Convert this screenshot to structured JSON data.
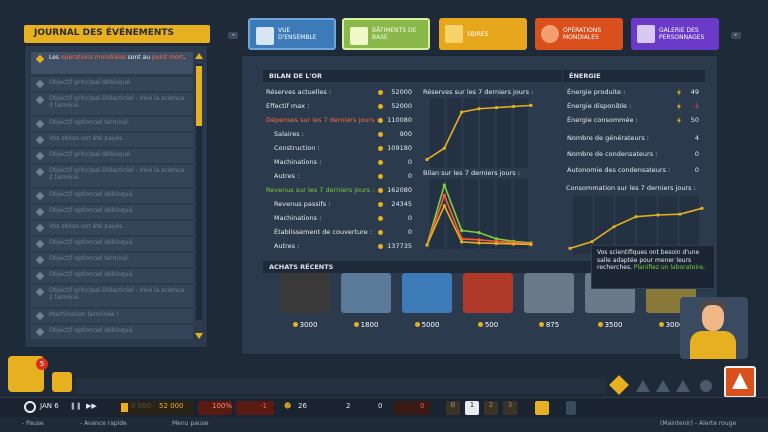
{
  "journal": {
    "title": "JOURNAL DES ÉVÉNEMENTS",
    "items": [
      {
        "pre": "Les ",
        "hl": "opérations mondiales",
        "mid": " sont au ",
        "hl2": "point mort",
        "post": ".",
        "active": true
      },
      {
        "text": "Objectif principal débloqué."
      },
      {
        "text": "Objectif principal Didacticiel - Vive la science 3 terminé."
      },
      {
        "text": "Objectif optionnel terminé."
      },
      {
        "text": "Vos sbires ont été payés."
      },
      {
        "text": "Objectif principal débloqué."
      },
      {
        "text": "Objectif principal Didacticiel - Vive la science 2 terminé."
      },
      {
        "text": "Objectif optionnel débloqué."
      },
      {
        "text": "Objectif optionnel débloqué."
      },
      {
        "text": "Vos sbires ont été payés."
      },
      {
        "text": "Objectif optionnel débloqué."
      },
      {
        "text": "Objectif optionnel terminé."
      },
      {
        "text": "Objectif optionnel débloqué."
      },
      {
        "text": "Objectif principal Didacticiel - Vive la science 1 terminé."
      },
      {
        "text": "Machination terminée !"
      },
      {
        "text": "Objectif optionnel débloqué."
      }
    ]
  },
  "tabs": [
    {
      "label": "VUE D'ENSEMBLE",
      "icon": "clipboard-icon"
    },
    {
      "label": "BÂTIMENTS DE BASE",
      "icon": "tools-icon"
    },
    {
      "label": "SBIRES",
      "icon": "minion-icon"
    },
    {
      "label": "OPÉRATIONS MONDIALES",
      "icon": "globe-icon"
    },
    {
      "label": "GALERIE DES PERSONNAGES",
      "icon": "portrait-icon"
    }
  ],
  "tab_keys": {
    "left": "◂",
    "right": "▸"
  },
  "gold": {
    "header": "BILAN DE L'OR",
    "reserves_label": "Réserves actuelles :",
    "reserves_value": "52000",
    "effectif_label": "Effectif max :",
    "effectif_value": "52000",
    "depenses_label": "Dépenses sur les 7 derniers jours :",
    "depenses_value": "110080",
    "salaires_label": "Salaires :",
    "salaires_value": "900",
    "construction_label": "Construction :",
    "construction_value": "109180",
    "machinations_label": "Machinations :",
    "machinations_value": "0",
    "autres_label": "Autres :",
    "autres_value": "0",
    "revenus_label": "Revenus sur les 7 derniers jours :",
    "revenus_value": "162080",
    "passifs_label": "Revenus passifs :",
    "passifs_value": "24345",
    "machinations2_label": "Machinations :",
    "machinations2_value": "0",
    "couverture_label": "Établissement de couverture :",
    "couverture_value": "0",
    "autres2_label": "Autres :",
    "autres2_value": "137735"
  },
  "energie": {
    "header": "ÉNERGIE",
    "produite_label": "Énergie produite :",
    "produite_value": "49",
    "disponible_label": "Énergie disponible :",
    "disponible_value": "-1",
    "consommee_label": "Énergie consommée :",
    "consommee_value": "50",
    "generateurs_label": "Nombre de générateurs :",
    "generateurs_value": "4",
    "condensateurs_label": "Nombre de condensateurs :",
    "condensateurs_value": "0",
    "autonomie_label": "Autonomie des condensateurs :",
    "autonomie_value": "0",
    "consommation_title": "Consommation sur les 7 derniers jours :"
  },
  "chart_data": [
    {
      "type": "line",
      "title": "Réserves sur les 7 derniers jours :",
      "x": [
        1,
        2,
        3,
        4,
        5,
        6,
        7
      ],
      "series": [
        {
          "values": [
            4000,
            14000,
            46000,
            49000,
            50000,
            51000,
            52000
          ],
          "color": "#e6b020"
        }
      ],
      "ylim": [
        0,
        55000
      ]
    },
    {
      "type": "line",
      "title": "Bilan sur les 7 derniers jours :",
      "x": [
        1,
        2,
        3,
        4,
        5,
        6,
        7
      ],
      "series": [
        {
          "values": [
            0,
            58000,
            14000,
            12000,
            6000,
            3500,
            2000
          ],
          "color": "#7ccf3e"
        },
        {
          "values": [
            0,
            48000,
            6000,
            5000,
            3500,
            2500,
            1200
          ],
          "color": "#ff5a3a"
        },
        {
          "values": [
            0,
            38000,
            3000,
            2000,
            1500,
            1000,
            500
          ],
          "color": "#e6b020"
        }
      ],
      "ylim": [
        0,
        60000
      ]
    },
    {
      "type": "line",
      "title": "Consommation sur les 7 derniers jours :",
      "x": [
        1,
        2,
        3,
        4,
        5,
        6,
        7
      ],
      "series": [
        {
          "values": [
            2,
            10,
            28,
            40,
            42,
            43,
            50
          ],
          "color": "#e6b020"
        }
      ],
      "ylim": [
        0,
        60
      ]
    }
  ],
  "achats": {
    "header": "ACHATS RÉCENTS",
    "items": [
      {
        "price": "3000",
        "color": "#3a3a3a",
        "icon": "generator-icon"
      },
      {
        "price": "1800",
        "color": "#5a7a9a",
        "icon": "room-icon"
      },
      {
        "price": "5000",
        "color": "#3d7ab8",
        "icon": "computer-icon"
      },
      {
        "price": "500",
        "color": "#b03a2a",
        "icon": "cabinet-icon"
      },
      {
        "price": "875",
        "color": "#6a7a8a",
        "icon": "room-icon"
      },
      {
        "price": "3500",
        "color": "#6a7a8a",
        "icon": "room-icon"
      },
      {
        "price": "3000",
        "color": "#8a7a3a",
        "icon": "machine-icon"
      }
    ]
  },
  "tooltip": {
    "text": "Vos scientifiques ont besoin d'une salle adaptée pour mener leurs recherches. ",
    "link": "Planifiez un laboratoire",
    "end": "."
  },
  "bottom": {
    "date": "JAN 6",
    "gold_dim": "0 000",
    "gold": "52 000",
    "percent": "100%",
    "energy": "-1",
    "minions": "26",
    "vol": "2",
    "zero1": "0",
    "zero2": "0",
    "speed_keys": [
      "B",
      "1",
      "2",
      "3"
    ],
    "notif_count": "5"
  },
  "footer": {
    "pause": "- Pause",
    "fast": "- Avance rapide",
    "menu": "Menu pause",
    "alert": "(Maintenir) - Alerte rouge"
  },
  "colors": {
    "accent": "#e6b020",
    "panel": "#2b3a4d",
    "bg": "#1f2a38",
    "red": "#ff5a3a",
    "green": "#7ccf3e"
  }
}
